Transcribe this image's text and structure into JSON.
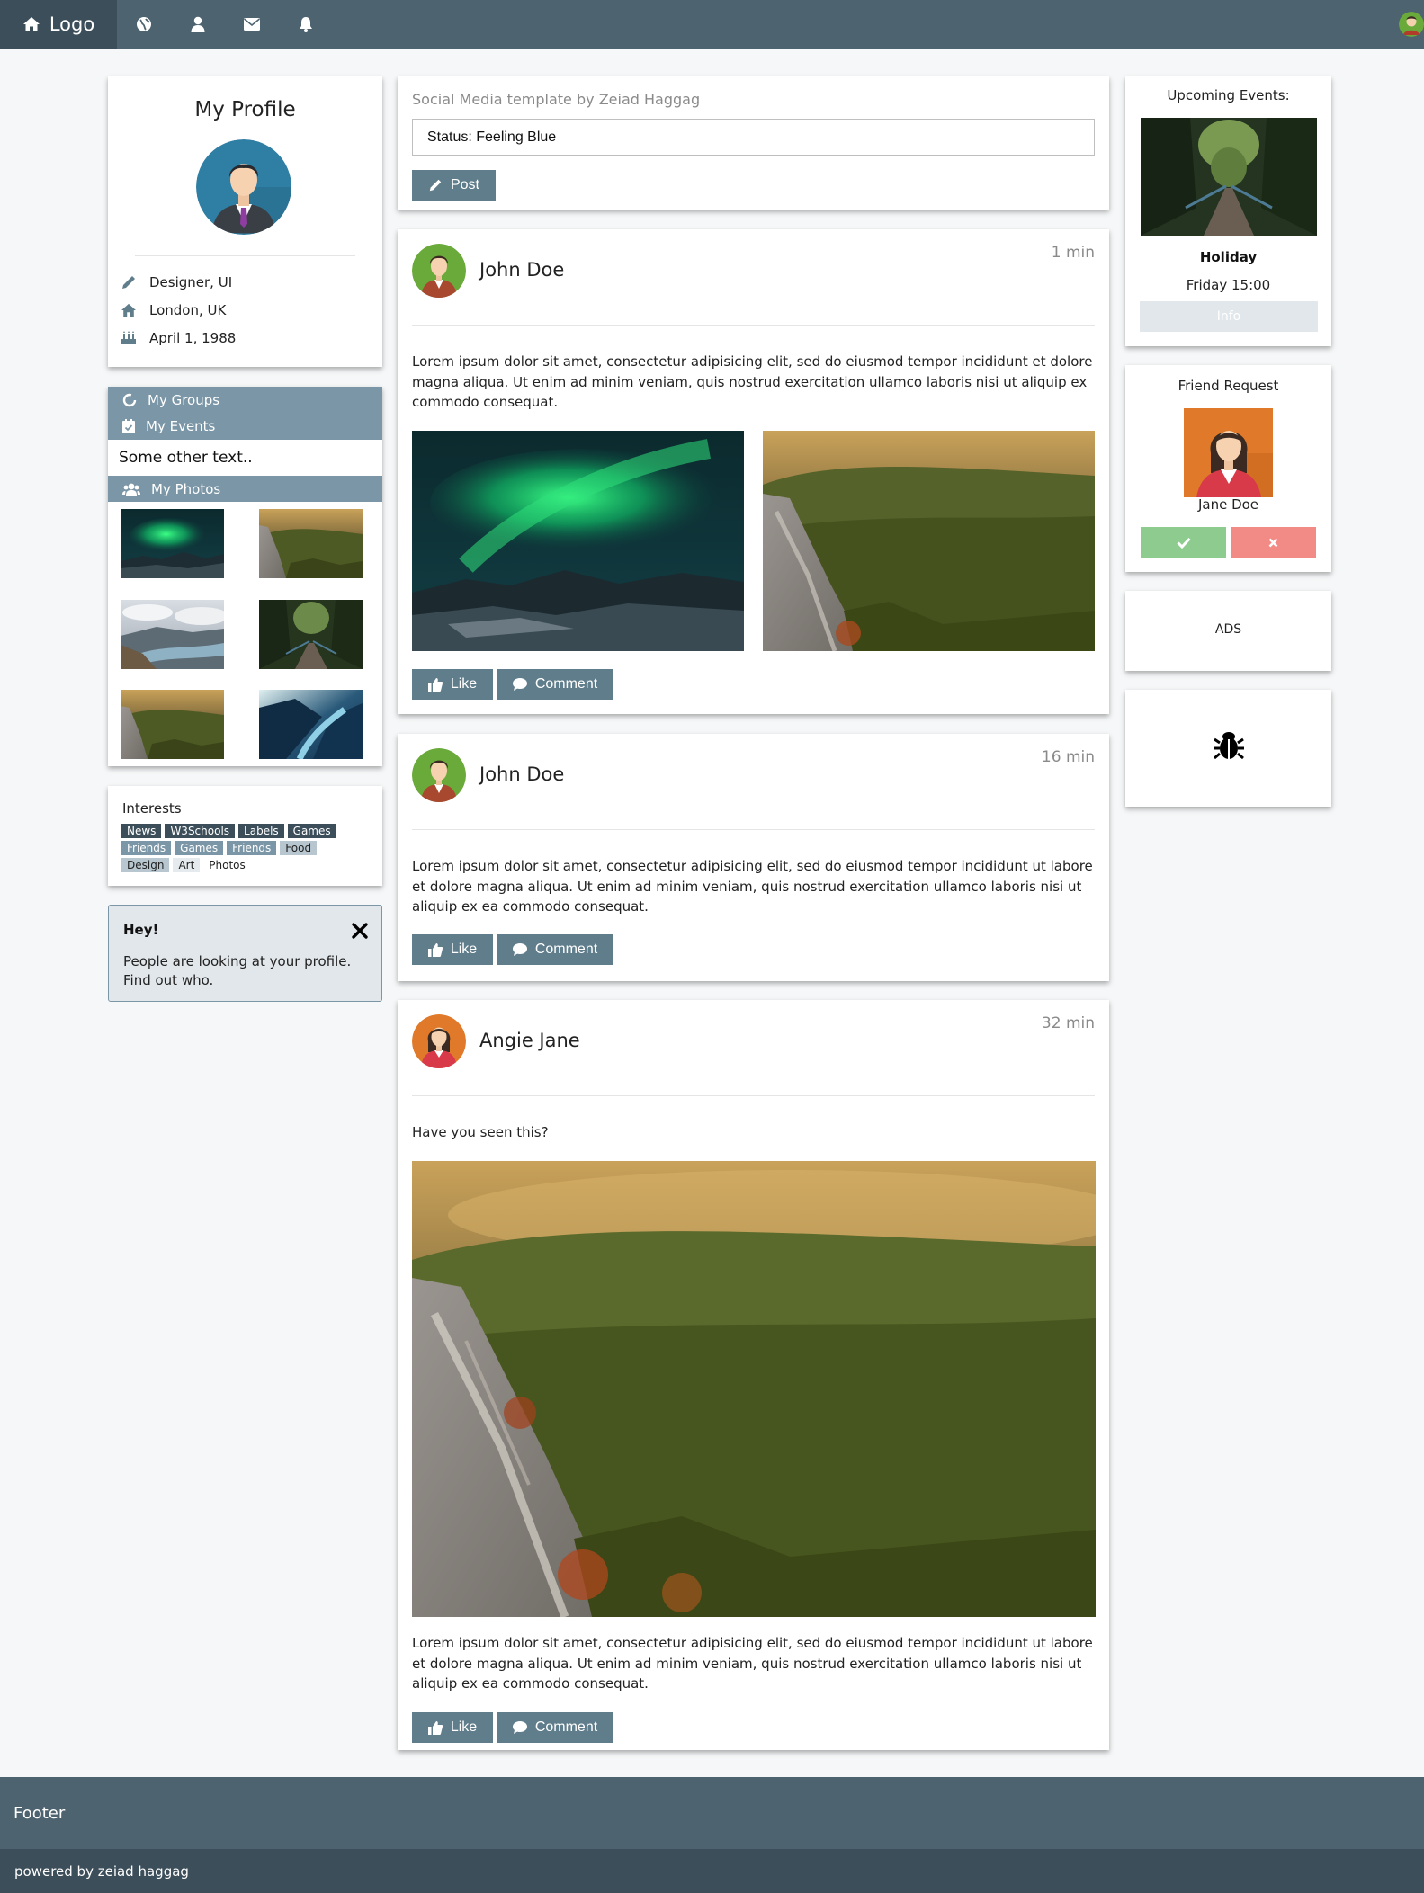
{
  "nav": {
    "logo_label": "Logo",
    "icons": [
      "home-icon",
      "globe-icon",
      "user-icon",
      "envelope-icon",
      "bell-icon"
    ]
  },
  "colors": {
    "nav_bg": "#4d636f",
    "nav_dark": "#3b4e5a",
    "theme": "#607d8b",
    "theme_light": "#7b96a6",
    "accept": "#8ecb8e",
    "decline": "#f28b86"
  },
  "profile": {
    "title": "My Profile",
    "job": "Designer, UI",
    "location": "London, UK",
    "birthday": "April 1, 1988"
  },
  "menu": {
    "groups": "My Groups",
    "events": "My Events",
    "other": "Some other text..",
    "photos": "My Photos"
  },
  "interests": {
    "title": "Interests",
    "tags": [
      "News",
      "W3Schools",
      "Labels",
      "Games",
      "Friends",
      "Games",
      "Friends",
      "Food",
      "Design",
      "Art",
      "Photos"
    ]
  },
  "alert": {
    "title": "Hey!",
    "text": "People are looking at your profile. Find out who."
  },
  "status": {
    "hint": "Social Media template by Zeiad Haggag",
    "value": "Status: Feeling Blue",
    "post_label": "Post"
  },
  "posts": [
    {
      "name": "John Doe",
      "time": "1 min",
      "text": "Lorem ipsum dolor sit amet, consectetur adipisicing elit, sed do eiusmod tempor incididunt et dolore magna aliqua. Ut enim ad minim veniam, quis nostrud exercitation ullamco laboris nisi ut aliquip ex commodo consequat."
    },
    {
      "name": "John Doe",
      "time": "16 min",
      "text": "Lorem ipsum dolor sit amet, consectetur adipisicing elit, sed do eiusmod tempor incididunt ut labore et dolore magna aliqua. Ut enim ad minim veniam, quis nostrud exercitation ullamco laboris nisi ut aliquip ex ea commodo consequat."
    },
    {
      "name": "Angie Jane",
      "time": "32 min",
      "text": "Have you seen this?",
      "text2": "Lorem ipsum dolor sit amet, consectetur adipisicing elit, sed do eiusmod tempor incididunt ut labore et dolore magna aliqua. Ut enim ad minim veniam, quis nostrud exercitation ullamco laboris nisi ut aliquip ex ea commodo consequat."
    }
  ],
  "actions": {
    "like": "Like",
    "comment": "Comment"
  },
  "events": {
    "title": "Upcoming Events:",
    "name": "Holiday",
    "when": "Friday 15:00",
    "info": "Info"
  },
  "friend_request": {
    "title": "Friend Request",
    "name": "Jane Doe"
  },
  "ads": "ADS",
  "footer": {
    "label": "Footer",
    "credit": "powered by zeiad haggag"
  }
}
